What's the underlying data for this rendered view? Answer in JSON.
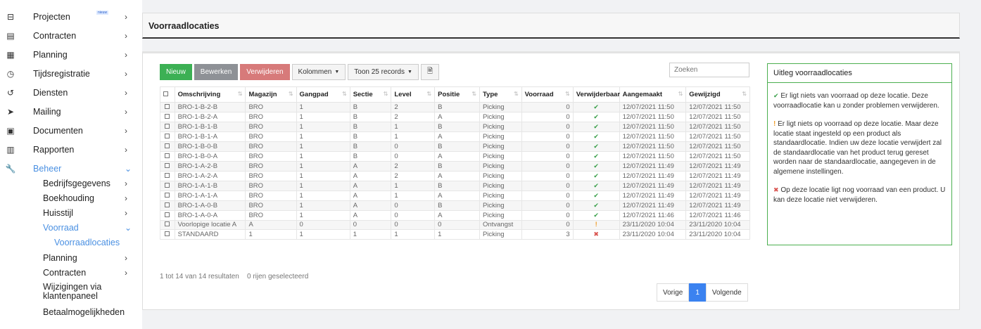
{
  "sidebar": {
    "projecten": {
      "label": "Projecten",
      "badge": "nieuw"
    },
    "contracten": {
      "label": "Contracten"
    },
    "planning": {
      "label": "Planning"
    },
    "tijdsregistratie": {
      "label": "Tijdsregistratie"
    },
    "diensten": {
      "label": "Diensten"
    },
    "mailing": {
      "label": "Mailing"
    },
    "documenten": {
      "label": "Documenten"
    },
    "rapporten": {
      "label": "Rapporten"
    },
    "beheer": {
      "label": "Beheer"
    },
    "bedrijfsgegevens": {
      "label": "Bedrijfsgegevens"
    },
    "boekhouding": {
      "label": "Boekhouding"
    },
    "huisstijl": {
      "label": "Huisstijl"
    },
    "voorraad": {
      "label": "Voorraad"
    },
    "voorraadlocaties": {
      "label": "Voorraadlocaties"
    },
    "planning2": {
      "label": "Planning"
    },
    "contracten2": {
      "label": "Contracten"
    },
    "wijzigingen": {
      "label": "Wijzigingen via klantenpaneel"
    },
    "betaal": {
      "label": "Betaalmogelijkheden"
    }
  },
  "header": {
    "title": "Voorraadlocaties"
  },
  "toolbar": {
    "new": "Nieuw",
    "edit": "Bewerken",
    "delete": "Verwijderen",
    "columns": "Kolommen",
    "show": "Toon 25 records"
  },
  "search": {
    "placeholder": "Zoeken"
  },
  "table": {
    "headers": [
      "Omschrijving",
      "Magazijn",
      "Gangpad",
      "Sectie",
      "Level",
      "Positie",
      "Type",
      "Voorraad",
      "Verwijderbaar",
      "Aangemaakt",
      "Gewijzigd"
    ],
    "rows": [
      [
        "BRO-1-B-2-B",
        "BRO",
        "1",
        "B",
        "2",
        "B",
        "Picking",
        "0",
        "ok",
        "12/07/2021 11:50",
        "12/07/2021 11:50"
      ],
      [
        "BRO-1-B-2-A",
        "BRO",
        "1",
        "B",
        "2",
        "A",
        "Picking",
        "0",
        "ok",
        "12/07/2021 11:50",
        "12/07/2021 11:50"
      ],
      [
        "BRO-1-B-1-B",
        "BRO",
        "1",
        "B",
        "1",
        "B",
        "Picking",
        "0",
        "ok",
        "12/07/2021 11:50",
        "12/07/2021 11:50"
      ],
      [
        "BRO-1-B-1-A",
        "BRO",
        "1",
        "B",
        "1",
        "A",
        "Picking",
        "0",
        "ok",
        "12/07/2021 11:50",
        "12/07/2021 11:50"
      ],
      [
        "BRO-1-B-0-B",
        "BRO",
        "1",
        "B",
        "0",
        "B",
        "Picking",
        "0",
        "ok",
        "12/07/2021 11:50",
        "12/07/2021 11:50"
      ],
      [
        "BRO-1-B-0-A",
        "BRO",
        "1",
        "B",
        "0",
        "A",
        "Picking",
        "0",
        "ok",
        "12/07/2021 11:50",
        "12/07/2021 11:50"
      ],
      [
        "BRO-1-A-2-B",
        "BRO",
        "1",
        "A",
        "2",
        "B",
        "Picking",
        "0",
        "ok",
        "12/07/2021 11:49",
        "12/07/2021 11:49"
      ],
      [
        "BRO-1-A-2-A",
        "BRO",
        "1",
        "A",
        "2",
        "A",
        "Picking",
        "0",
        "ok",
        "12/07/2021 11:49",
        "12/07/2021 11:49"
      ],
      [
        "BRO-1-A-1-B",
        "BRO",
        "1",
        "A",
        "1",
        "B",
        "Picking",
        "0",
        "ok",
        "12/07/2021 11:49",
        "12/07/2021 11:49"
      ],
      [
        "BRO-1-A-1-A",
        "BRO",
        "1",
        "A",
        "1",
        "A",
        "Picking",
        "0",
        "ok",
        "12/07/2021 11:49",
        "12/07/2021 11:49"
      ],
      [
        "BRO-1-A-0-B",
        "BRO",
        "1",
        "A",
        "0",
        "B",
        "Picking",
        "0",
        "ok",
        "12/07/2021 11:49",
        "12/07/2021 11:49"
      ],
      [
        "BRO-1-A-0-A",
        "BRO",
        "1",
        "A",
        "0",
        "A",
        "Picking",
        "0",
        "ok",
        "12/07/2021 11:46",
        "12/07/2021 11:46"
      ],
      [
        "Voorlopige locatie A",
        "A",
        "0",
        "0",
        "0",
        "0",
        "Ontvangst",
        "0",
        "warn",
        "23/11/2020 10:04",
        "23/11/2020 10:04"
      ],
      [
        "STANDAARD",
        "1",
        "1",
        "1",
        "1",
        "1",
        "Picking",
        "3",
        "err",
        "23/11/2020 10:04",
        "23/11/2020 10:04"
      ]
    ]
  },
  "summary": {
    "results": "1 tot 14 van 14 resultaten",
    "selected": "0 rijen geselecteerd"
  },
  "pager": {
    "prev": "Vorige",
    "page": "1",
    "next": "Volgende"
  },
  "info": {
    "title": "Uitleg voorraadlocaties",
    "p1": "Er ligt niets van voorraad op deze locatie. Deze voorraadlocatie kan u zonder problemen verwijderen.",
    "p2": "Er ligt niets op voorraad op deze locatie. Maar deze locatie staat ingesteld op een product als standaardlocatie. Indien uw deze locatie verwijdert zal de standaardlocatie van het product terug gereset worden naar de standaardlocatie, aangegeven in de algemene instellingen.",
    "p3": "Op deze locatie ligt nog voorraad van een product. U kan deze locatie niet verwijderen."
  },
  "colors": {
    "green": "#3cb054",
    "gray": "#8e9196",
    "red": "#d77a7a",
    "accent": "#4a90e2",
    "info_border": "#4caf50"
  }
}
